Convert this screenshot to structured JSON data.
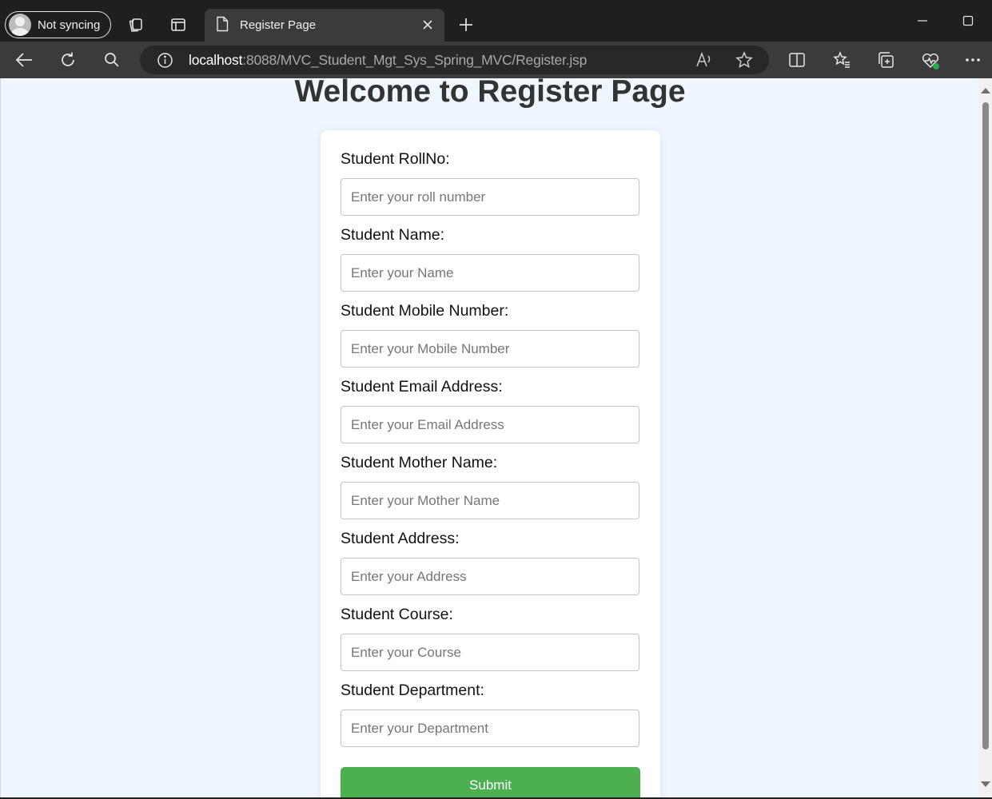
{
  "browser": {
    "profile_label": "Not syncing",
    "tab_title": "Register Page",
    "url_host": "localhost",
    "url_path": ":8088/MVC_Student_Mgt_Sys_Spring_MVC/Register.jsp"
  },
  "page": {
    "title": "Welcome to Register Page",
    "fields": [
      {
        "label": "Student RollNo:",
        "placeholder": "Enter your roll number"
      },
      {
        "label": "Student Name:",
        "placeholder": "Enter your Name"
      },
      {
        "label": "Student Mobile Number:",
        "placeholder": "Enter your Mobile Number"
      },
      {
        "label": "Student Email Address:",
        "placeholder": "Enter your Email Address"
      },
      {
        "label": "Student Mother Name:",
        "placeholder": "Enter your Mother Name"
      },
      {
        "label": "Student Address:",
        "placeholder": "Enter your Address"
      },
      {
        "label": "Student Course:",
        "placeholder": "Enter your Course"
      },
      {
        "label": "Student Department:",
        "placeholder": "Enter your Department"
      }
    ],
    "submit_label": "Submit"
  },
  "colors": {
    "page_background": "#eef6ff",
    "submit_button": "#4caf50",
    "title_text": "#333333"
  }
}
